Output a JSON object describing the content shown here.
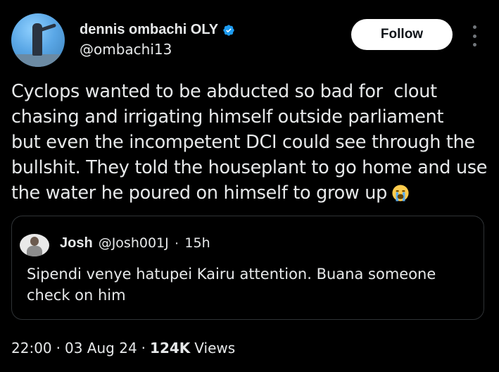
{
  "author": {
    "display_name": "dennis ombachi OLY",
    "handle": "@ombachi13",
    "verified": true,
    "verified_color": "#1d9bf0"
  },
  "actions": {
    "follow_label": "Follow",
    "more_icon": "more-vertical-icon"
  },
  "tweet": {
    "text": "Cyclops wanted to be abducted so bad for  clout\nchasing and irrigating himself outside parliament\nbut even the incompetent DCI could see through the\nbullshit. They told the houseplant to go home and use\nthe water he poured on himself to grow up",
    "emoji": "loudly-crying-face-emoji"
  },
  "quote": {
    "name": "Josh",
    "handle": "@Josh001J",
    "separator": "·",
    "time": "15h",
    "text": "Sipendi venye hatupei Kairu attention. Buana someone check on him"
  },
  "meta": {
    "time": "22:00",
    "separator1": "·",
    "date": "03 Aug 24",
    "separator2": "·",
    "views_count": "124K",
    "views_label": "Views"
  },
  "colors": {
    "background": "#000000",
    "text": "#e7e9ea",
    "border": "#2f3336",
    "follow_bg": "#ffffff"
  }
}
